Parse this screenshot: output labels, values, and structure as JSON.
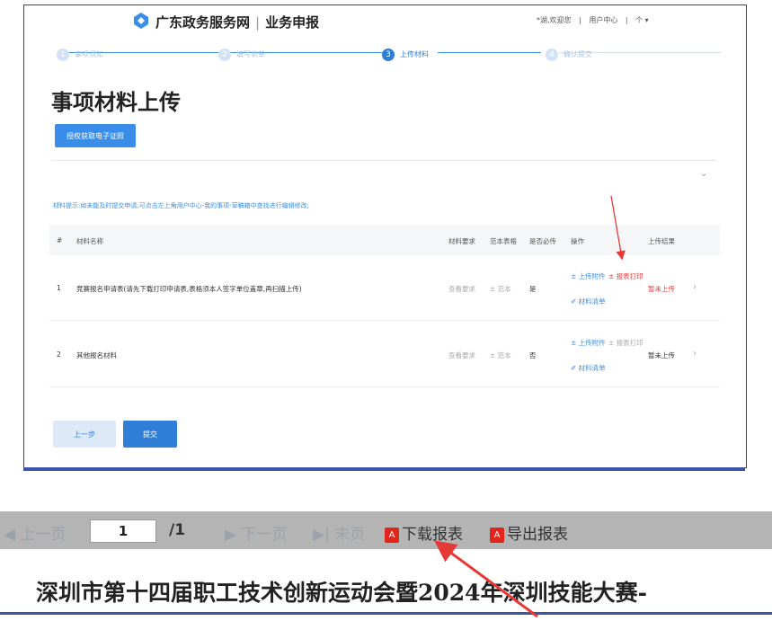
{
  "header": {
    "site_name": "广东政务服务网",
    "section": "业务申报",
    "user_nav": [
      "*湖,欢迎您",
      "用户中心",
      "个 ▾"
    ]
  },
  "steps": [
    {
      "num": "1",
      "label": "事项须知",
      "active": false
    },
    {
      "num": "2",
      "label": "填写表单",
      "active": false
    },
    {
      "num": "3",
      "label": "上传材料",
      "active": true
    },
    {
      "num": "4",
      "label": "确认提交",
      "active": false
    }
  ],
  "page_title": "事项材料上传",
  "auth_button": "授权获取电子证照",
  "notice": "材料提示:如未能及时提交申请,可点击左上角用户中心-我的事项-草稿箱中查找进行编辑修改;",
  "table": {
    "headers": [
      "#",
      "材料名称",
      "材料要求",
      "范本表格",
      "是否必传",
      "操作",
      "上传结果"
    ],
    "rows": [
      {
        "index": "1",
        "name": "竞赛报名申请表(请先下载打印申请表,表格须本人签字单位盖章,再扫描上传)",
        "requirement": "查看要求",
        "template": "± 范本",
        "required": "是",
        "op_upload": "± 上传附件",
        "op_download": "± 报表打印",
        "op_list": "✐ 材料清单",
        "result": "暂未上传"
      },
      {
        "index": "2",
        "name": "其他报名材料",
        "requirement": "查看要求",
        "template": "± 范本",
        "required": "否",
        "op_upload": "± 上传附件",
        "op_download": "± 报表打印",
        "op_list": "✐ 材料清单",
        "result": "暂未上传"
      }
    ]
  },
  "buttons": {
    "prev": "上一步",
    "submit": "提交"
  },
  "report_toolbar": {
    "prev_page": "◀ 上一页",
    "page_value": "1",
    "page_total": "/1",
    "next_page": "▶ 下一页",
    "last_page": "▶| 末页",
    "download": "下载报表",
    "export": "导出报表"
  },
  "report_title": "深圳市第十四届职工技术创新运动会暨2024年深圳技能大赛-",
  "colors": {
    "accent": "#2f7fd8",
    "annotation_arrow": "#e53935",
    "warning": "#e23b3b"
  }
}
